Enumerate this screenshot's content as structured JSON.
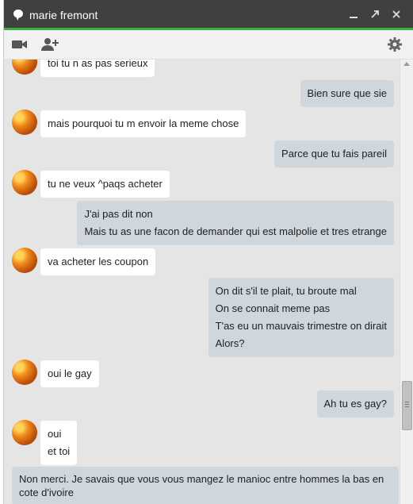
{
  "header": {
    "contact_name": "marie fremont",
    "accent_color": "#3cb23c",
    "titlebar_color": "#404040",
    "icons": [
      "chat-bubble-icon",
      "minimize-icon",
      "popout-icon",
      "close-icon"
    ]
  },
  "toolbar": {
    "icons": [
      "video-call-icon",
      "add-person-icon",
      "settings-icon"
    ]
  },
  "messages": [
    {
      "from": "contact",
      "lines": [
        "toi tu n as pas serieux"
      ]
    },
    {
      "from": "me",
      "lines": [
        "Bien sure que sie"
      ]
    },
    {
      "from": "contact",
      "lines": [
        "mais pourquoi tu m envoir la meme chose"
      ]
    },
    {
      "from": "me",
      "lines": [
        "Parce que tu fais pareil"
      ]
    },
    {
      "from": "contact",
      "lines": [
        "tu ne veux ^paqs acheter"
      ]
    },
    {
      "from": "me",
      "lines": [
        "J'ai pas dit non",
        "Mais tu as une facon de demander qui est malpolie et tres etrange"
      ]
    },
    {
      "from": "contact",
      "lines": [
        "va acheter les coupon"
      ]
    },
    {
      "from": "me",
      "lines": [
        "On dit s'il te plait, tu broute mal",
        "On se connait meme pas",
        "T'as eu un mauvais trimestre on dirait",
        "Alors?"
      ]
    },
    {
      "from": "contact",
      "lines": [
        "oui le gay"
      ]
    },
    {
      "from": "me",
      "lines": [
        "Ah tu es gay?"
      ]
    },
    {
      "from": "contact",
      "lines": [
        "oui",
        "et toi"
      ]
    },
    {
      "from": "me",
      "lines": [
        "Non merci. Je savais que vous vous mangez le manioc entre hommes la bas en cote d'ivoire"
      ]
    }
  ]
}
